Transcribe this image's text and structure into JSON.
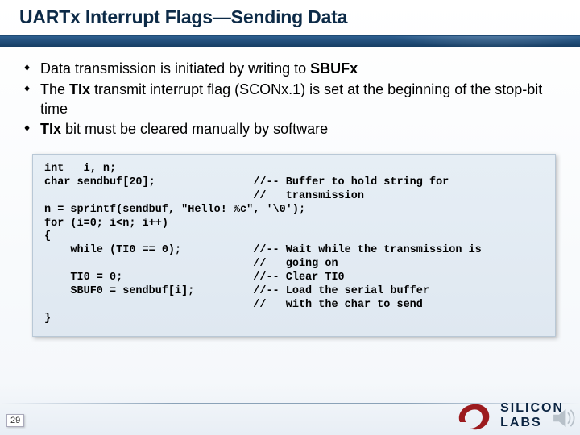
{
  "title": "UARTx Interrupt Flags—Sending Data",
  "bullets": [
    {
      "pre": "Data transmission is initiated by writing to ",
      "bold": "SBUFx",
      "post": ""
    },
    {
      "pre": "The ",
      "bold": "TIx",
      "post": " transmit interrupt flag (SCONx.1) is set at the beginning of the stop-bit time"
    },
    {
      "pre": "",
      "bold": "TIx",
      "post": " bit must be cleared manually by software"
    }
  ],
  "code": "int   i, n;\nchar sendbuf[20];               //-- Buffer to hold string for\n                                //   transmission\nn = sprintf(sendbuf, \"Hello! %c\", '\\0');\nfor (i=0; i<n; i++)\n{\n    while (TI0 == 0);           //-- Wait while the transmission is\n                                //   going on\n    TI0 = 0;                    //-- Clear TI0\n    SBUF0 = sendbuf[i];         //-- Load the serial buffer\n                                //   with the char to send\n}",
  "page_number": "29",
  "logo": {
    "line1": "SILICON",
    "line2": "LABS"
  }
}
